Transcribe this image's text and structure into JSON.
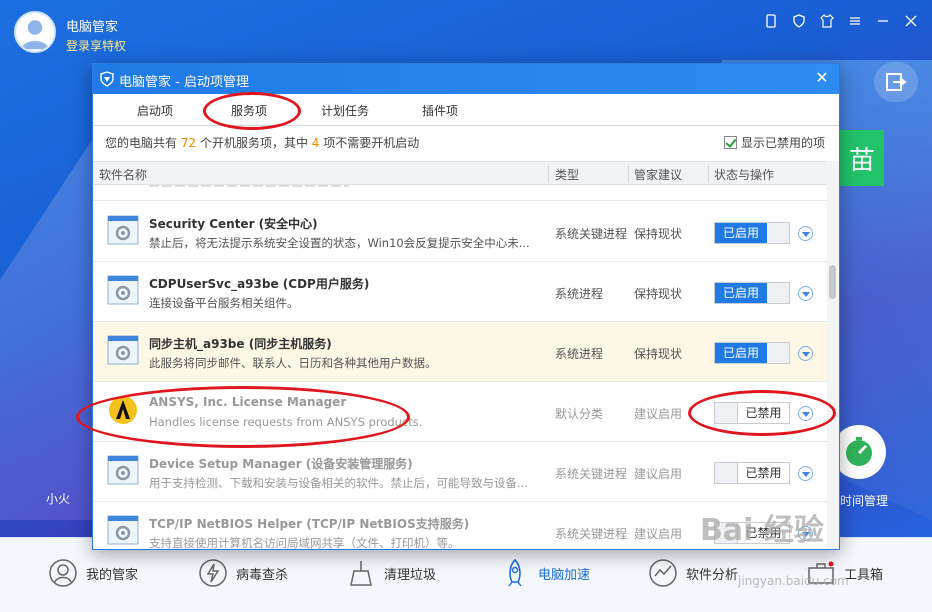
{
  "app": {
    "title": "电脑管家",
    "login": "登录享特权",
    "green_button_glyph": "苗",
    "small_label": "小火",
    "timer_label": "时间管理"
  },
  "dialog": {
    "title": "电脑管家 - 启动项管理",
    "tabs": [
      "启动项",
      "服务项",
      "计划任务",
      "插件项"
    ],
    "active_tab": "服务项",
    "summary": {
      "prefix": "您的电脑共有",
      "total": "72",
      "middle": "个开机服务项，其中",
      "unneeded": "4",
      "suffix": "项不需要开机启动"
    },
    "show_disabled_label": "显示已禁用的项",
    "columns": [
      "软件名称",
      "类型",
      "管家建议",
      "状态与操作"
    ],
    "rows": [
      {
        "name": "Security Center (安全中心)",
        "desc": "禁止后，将无法提示系统安全设置的状态，Win10会反复提示安全中心未...",
        "type": "系统关键进程",
        "advice": "保持现状",
        "status": "已启用",
        "state": "on"
      },
      {
        "name": "CDPUserSvc_a93be (CDP用户服务)",
        "desc": "连接设备平台服务相关组件。",
        "type": "系统进程",
        "advice": "保持现状",
        "status": "已启用",
        "state": "on"
      },
      {
        "name": "同步主机_a93be (同步主机服务)",
        "desc": "此服务将同步邮件、联系人、日历和各种其他用户数据。",
        "type": "系统进程",
        "advice": "保持现状",
        "status": "已启用",
        "state": "on"
      },
      {
        "name": "ANSYS, Inc. License Manager",
        "desc": "Handles license requests from ANSYS products.",
        "type": "默认分类",
        "advice": "建议启用",
        "status": "已禁用",
        "state": "off"
      },
      {
        "name": "Device Setup Manager (设备安装管理服务)",
        "desc": "用于支持检测、下载和安装与设备相关的软件。禁止后，可能导致与设备...",
        "type": "系统关键进程",
        "advice": "建议启用",
        "status": "已禁用",
        "state": "off"
      },
      {
        "name": "TCP/IP NetBIOS Helper (TCP/IP NetBIOS支持服务)",
        "desc": "支持直接使用计算机名访问局域网共享（文件、打印机）等。",
        "type": "系统关键进程",
        "advice": "建议启用",
        "status": "已禁用",
        "state": "off"
      }
    ]
  },
  "bottom_nav": [
    "我的管家",
    "病毒查杀",
    "清理垃圾",
    "电脑加速",
    "软件分析",
    "工具箱"
  ],
  "active_nav": "电脑加速",
  "watermark": {
    "main": "Bai 经验",
    "sub": "jingyan.baidu.com"
  },
  "colors": {
    "accent": "#1f7ae6",
    "annotation": "#e0161e",
    "highlight_row": "#fdf8e6",
    "count": "#f08a00"
  }
}
